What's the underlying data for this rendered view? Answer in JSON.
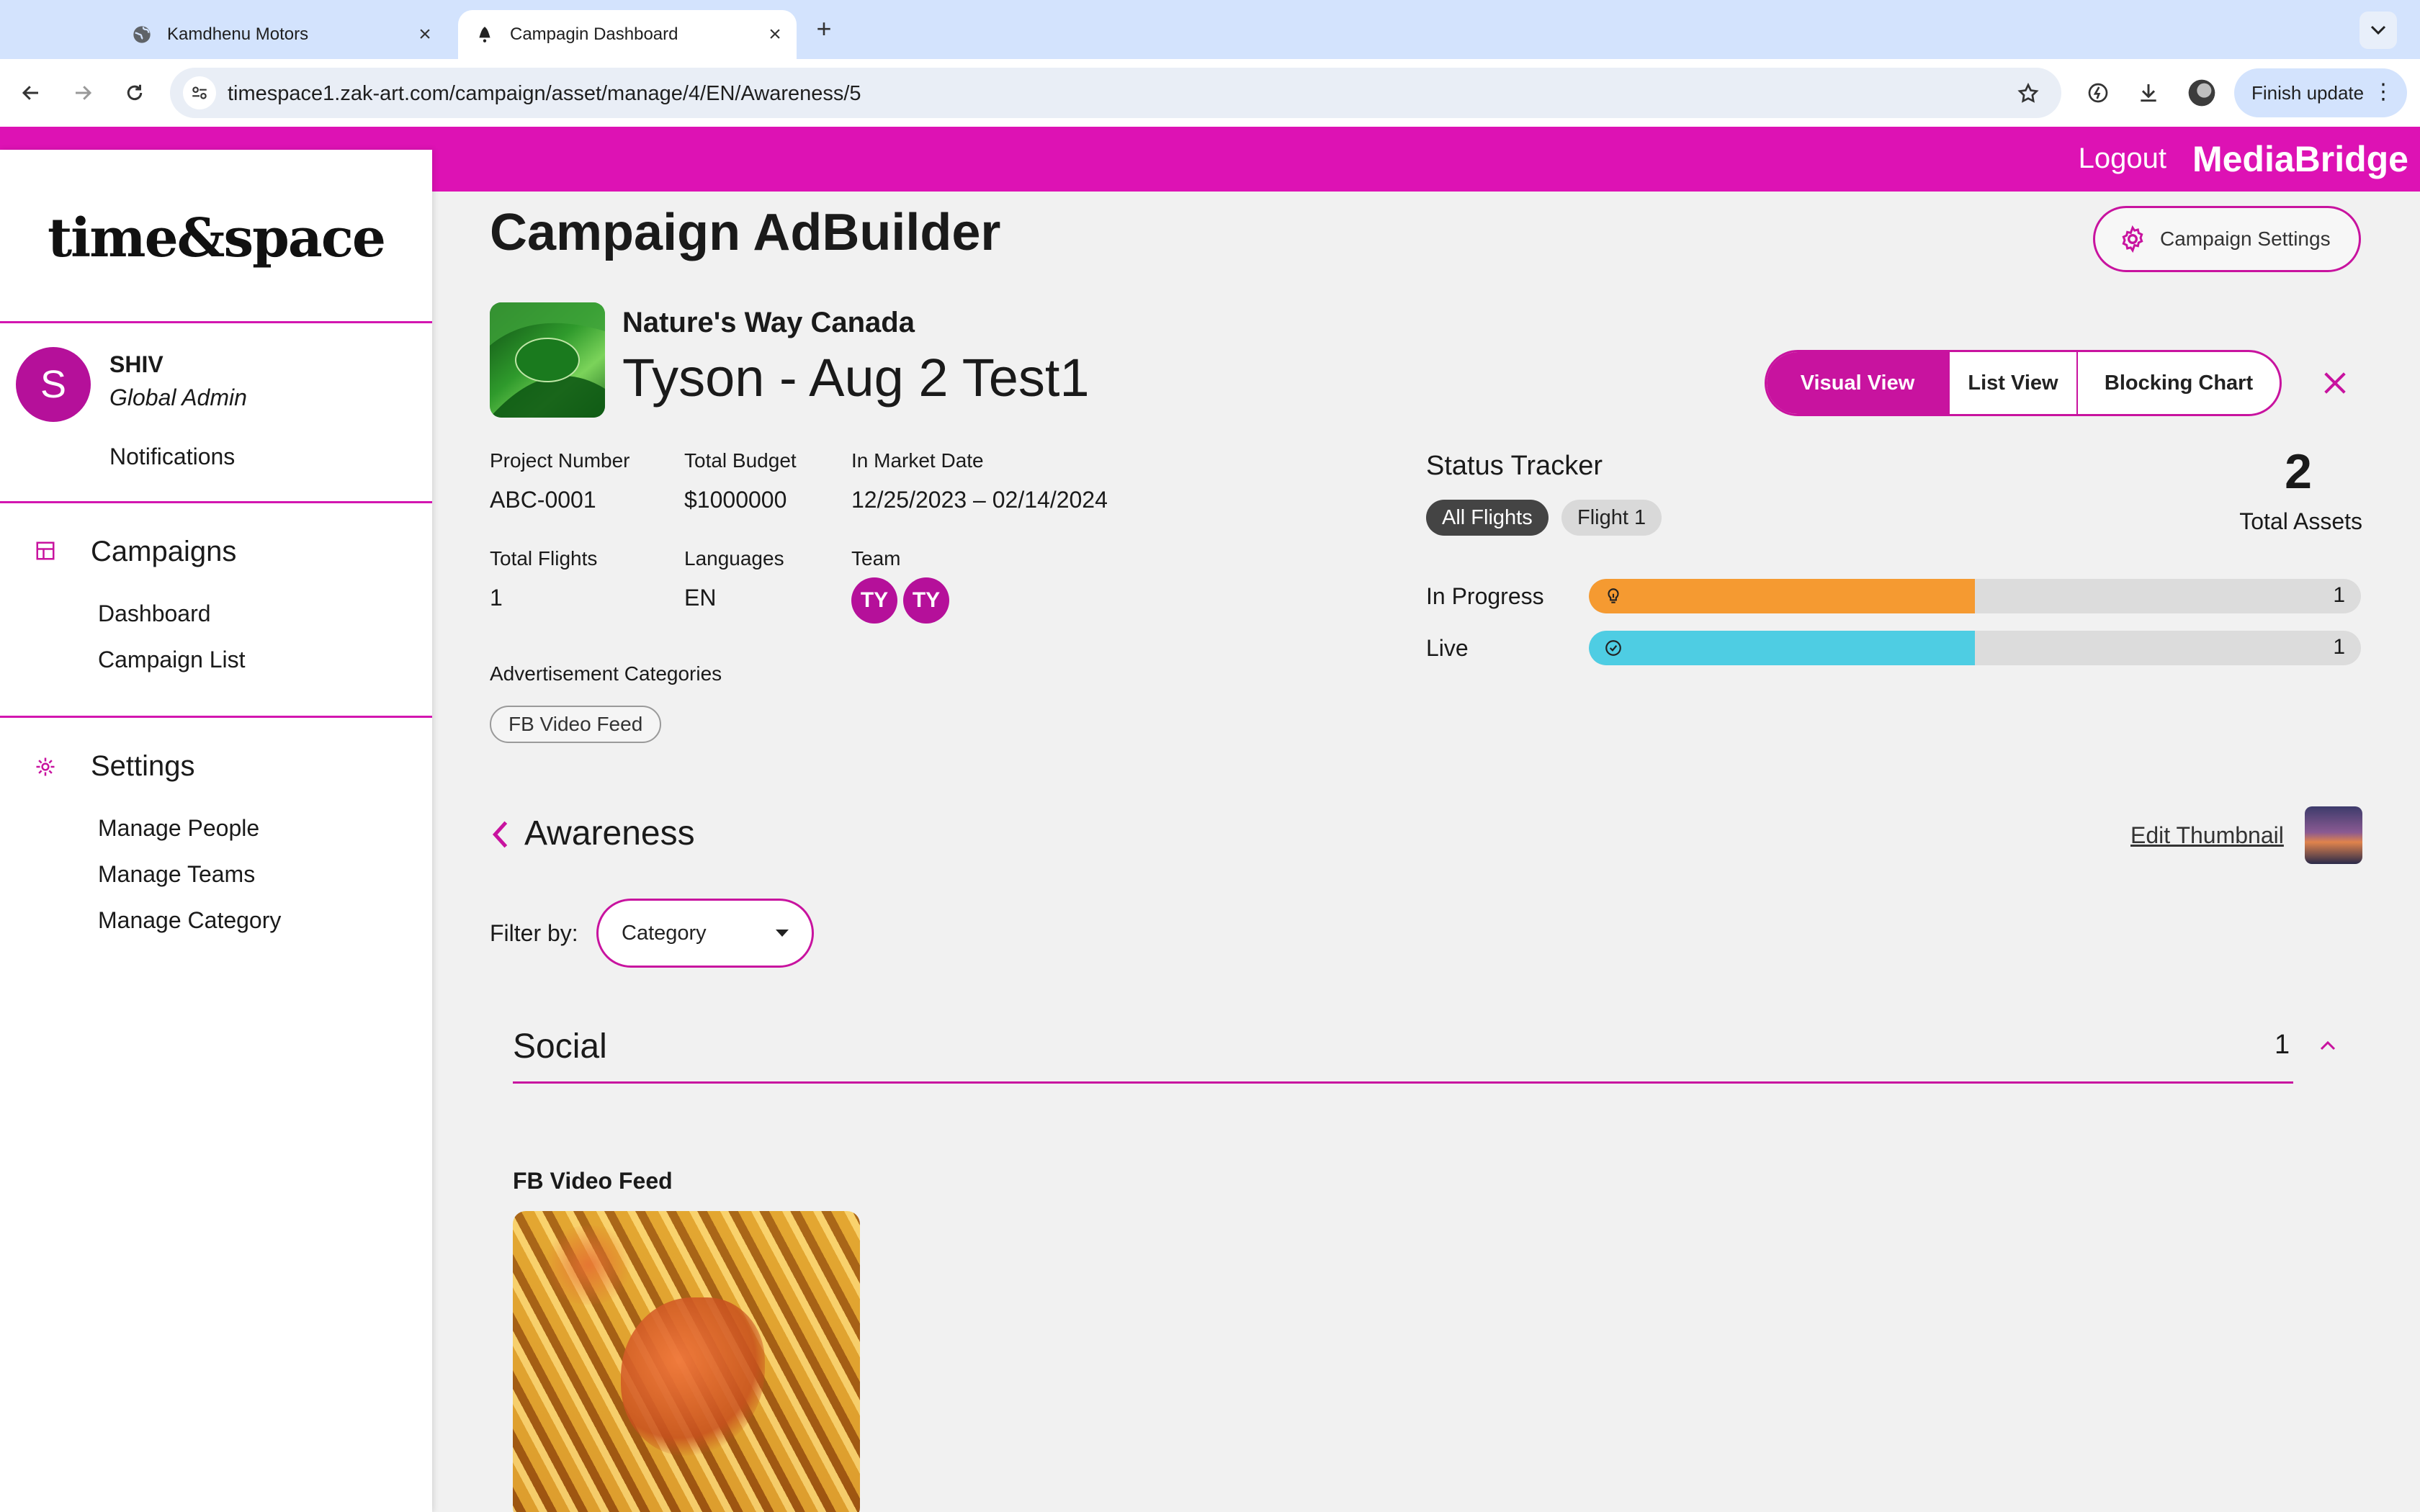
{
  "browser": {
    "tabs": [
      {
        "title": "Kamdhenu Motors",
        "icon": "globe-icon",
        "active": false
      },
      {
        "title": "Campagin Dashboard",
        "icon": "bell-icon",
        "active": true
      }
    ],
    "url": "timespace1.zak-art.com/campaign/asset/manage/4/EN/Awareness/5",
    "finish_update": "Finish update"
  },
  "header": {
    "logout": "Logout",
    "brand": "MediaBridge",
    "color": "#dd12b4"
  },
  "sidebar": {
    "logo": "time&space",
    "user": {
      "initial": "S",
      "name": "SHIV",
      "role": "Global Admin"
    },
    "notifications": "Notifications",
    "sections": [
      {
        "title": "Campaigns",
        "icon": "dashboard-icon",
        "links": [
          "Dashboard",
          "Campaign List"
        ]
      },
      {
        "title": "Settings",
        "icon": "gear-icon",
        "links": [
          "Manage People",
          "Manage Teams",
          "Manage Category"
        ]
      }
    ]
  },
  "main": {
    "page_title": "Campaign AdBuilder",
    "settings_button": "Campaign Settings",
    "client_name": "Nature's Way Canada",
    "campaign_name": "Tyson - Aug 2 Test1",
    "views": [
      "Visual View",
      "List View",
      "Blocking Chart"
    ],
    "active_view": "Visual View",
    "meta": {
      "project_number": {
        "label": "Project Number",
        "value": "ABC-0001"
      },
      "total_budget": {
        "label": "Total Budget",
        "value": "$1000000"
      },
      "in_market_date": {
        "label": "In Market Date",
        "value": "12/25/2023 – 02/14/2024"
      },
      "total_flights": {
        "label": "Total Flights",
        "value": "1"
      },
      "languages": {
        "label": "Languages",
        "value": "EN"
      },
      "team": {
        "label": "Team",
        "members": [
          "TY",
          "TY"
        ]
      }
    },
    "ad_categories": {
      "label": "Advertisement Categories",
      "items": [
        "FB Video Feed"
      ]
    },
    "status_tracker": {
      "title": "Status Tracker",
      "flight_filters": [
        "All Flights",
        "Flight 1"
      ],
      "active_filter": "All Flights",
      "total_assets": "2",
      "total_assets_label": "Total Assets",
      "bars": [
        {
          "label": "In Progress",
          "count": "1",
          "fraction": 0.5,
          "color": "#f59a31",
          "icon": "lightbulb-icon"
        },
        {
          "label": "Live",
          "count": "1",
          "fraction": 0.5,
          "color": "#4ecde3",
          "icon": "check-circle-icon"
        }
      ]
    },
    "section": {
      "name": "Awareness",
      "edit_thumbnail": "Edit Thumbnail",
      "filter_label": "Filter by:",
      "filter_value": "Category"
    },
    "groups": [
      {
        "title": "Social",
        "count": "1",
        "assets": [
          {
            "label": "FB Video Feed"
          }
        ]
      }
    ]
  }
}
